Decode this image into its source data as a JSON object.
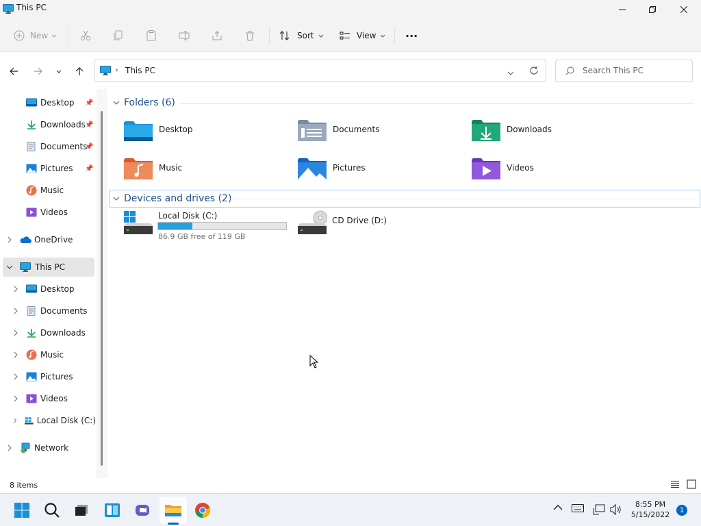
{
  "window": {
    "title": "This PC"
  },
  "toolbar": {
    "new_label": "New",
    "sort_label": "Sort",
    "view_label": "View",
    "more_label": "···"
  },
  "address": {
    "location": "This PC",
    "separator": "›"
  },
  "search": {
    "placeholder": "Search This PC"
  },
  "sidebar": {
    "quick_access": [
      {
        "label": "Desktop",
        "pinned": true
      },
      {
        "label": "Downloads",
        "pinned": true
      },
      {
        "label": "Documents",
        "pinned": true
      },
      {
        "label": "Pictures",
        "pinned": true
      },
      {
        "label": "Music",
        "pinned": false
      },
      {
        "label": "Videos",
        "pinned": false
      }
    ],
    "onedrive": "OneDrive",
    "thispc": "This PC",
    "thispc_children": [
      "Desktop",
      "Documents",
      "Downloads",
      "Music",
      "Pictures",
      "Videos",
      "Local Disk (C:)"
    ],
    "network": "Network"
  },
  "content": {
    "folders_header": "Folders (6)",
    "folders": [
      "Desktop",
      "Documents",
      "Downloads",
      "Music",
      "Pictures",
      "Videos"
    ],
    "devices_header": "Devices and drives (2)",
    "drives": [
      {
        "name": "Local Disk (C:)",
        "free_text": "86.9 GB free of 119 GB",
        "used_fraction": 0.27
      },
      {
        "name": "CD Drive (D:)"
      }
    ]
  },
  "status": {
    "items": "8 items"
  },
  "taskbar": {
    "time": "8:55 PM",
    "date": "5/15/2022",
    "notification_count": "1"
  },
  "colors": {
    "accent": "#0067c0",
    "drive_bar": "#26a0da",
    "group_header": "#1e4e8c"
  }
}
